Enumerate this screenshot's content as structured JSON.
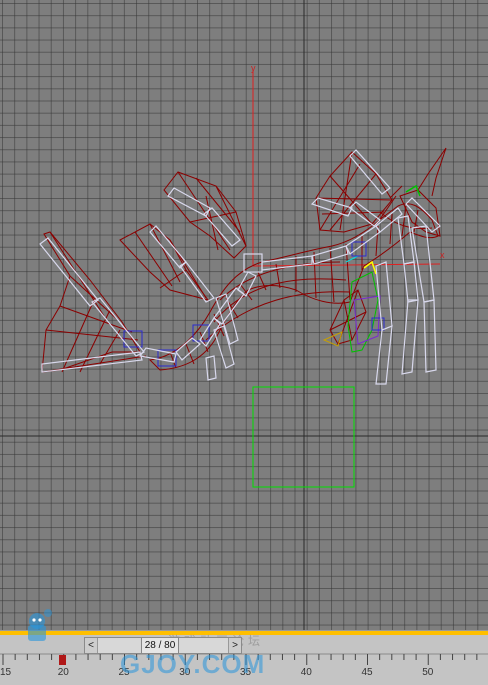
{
  "viewport": {
    "axis_y_label": "y",
    "axis_x_label": "x"
  },
  "timeline": {
    "frame_display": "28 / 80",
    "prev_label": "<",
    "next_label": ">",
    "ticks": [
      "15",
      "20",
      "25",
      "30",
      "35",
      "40",
      "45",
      "50"
    ]
  },
  "watermark": {
    "text": "GJOY.COM",
    "sub": "游戏动画论坛"
  },
  "colors": {
    "wire": "#8b0000",
    "bone": "#d8d8ec",
    "grid": "#7e7e7e",
    "selection": "#00e000",
    "axis": "#e02020"
  }
}
